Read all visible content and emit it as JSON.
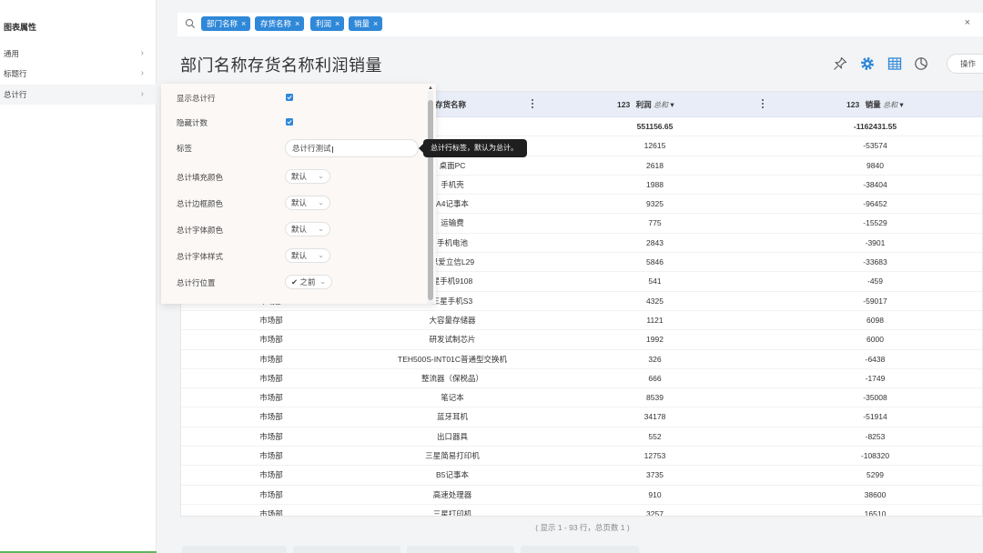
{
  "left_panel": {
    "title": "图表属性",
    "items": [
      {
        "label": "通用"
      },
      {
        "label": "标题行"
      },
      {
        "label": "总计行"
      }
    ]
  },
  "filters": {
    "chips": [
      {
        "label": "部门名称"
      },
      {
        "label": "存货名称"
      },
      {
        "label": "利润"
      },
      {
        "label": "销量"
      }
    ],
    "clear_symbol": "×"
  },
  "page_title": "部门名称存货名称利润销量",
  "toolbar": {
    "pin_icon": "pin-icon",
    "settings_icon": "gear-icon",
    "table_icon": "table-icon",
    "chart_icon": "pie-chart-icon",
    "operation_label": "操作",
    "accent_color": "#2f88d8"
  },
  "table": {
    "headers": {
      "col2": "存货名称",
      "col3_type": "123",
      "col3_name": "利润",
      "col3_agg": "总和",
      "col4_type": "123",
      "col4_name": "销量",
      "col4_agg": "总和"
    },
    "total_row": {
      "profit": "551156.65",
      "sales": "-1162431.55"
    },
    "rows": [
      {
        "dept": "",
        "item": "",
        "profit": "12615",
        "sales": "-53574"
      },
      {
        "dept": "",
        "item": "桌面PC",
        "profit": "2618",
        "sales": "9840"
      },
      {
        "dept": "",
        "item": "手机壳",
        "profit": "1988",
        "sales": "-38404"
      },
      {
        "dept": "",
        "item": "A4记事本",
        "profit": "9325",
        "sales": "-96452"
      },
      {
        "dept": "",
        "item": "运输费",
        "profit": "775",
        "sales": "-15529"
      },
      {
        "dept": "",
        "item": "手机电池",
        "profit": "2843",
        "sales": "-3901"
      },
      {
        "dept": "",
        "item": "思爱立信L29",
        "profit": "5846",
        "sales": "-33683"
      },
      {
        "dept": "",
        "item": "星手机9108",
        "profit": "541",
        "sales": "-459"
      },
      {
        "dept": "市场部",
        "item": "三星手机S3",
        "profit": "4325",
        "sales": "-59017"
      },
      {
        "dept": "市场部",
        "item": "大容量存储器",
        "profit": "1121",
        "sales": "6098"
      },
      {
        "dept": "市场部",
        "item": "研发试制芯片",
        "profit": "1992",
        "sales": "6000"
      },
      {
        "dept": "市场部",
        "item": "TEH500S-INT01C普通型交换机",
        "profit": "326",
        "sales": "-6438"
      },
      {
        "dept": "市场部",
        "item": "整流器（保税品）",
        "profit": "666",
        "sales": "-1749"
      },
      {
        "dept": "市场部",
        "item": "笔记本",
        "profit": "8539",
        "sales": "-35008"
      },
      {
        "dept": "市场部",
        "item": "蓝牙耳机",
        "profit": "34178",
        "sales": "-51914"
      },
      {
        "dept": "市场部",
        "item": "出口器具",
        "profit": "552",
        "sales": "-8253"
      },
      {
        "dept": "市场部",
        "item": "三星简易打印机",
        "profit": "12753",
        "sales": "-108320"
      },
      {
        "dept": "市场部",
        "item": "B5记事本",
        "profit": "3735",
        "sales": "5299"
      },
      {
        "dept": "市场部",
        "item": "高速处理器",
        "profit": "910",
        "sales": "38600"
      },
      {
        "dept": "市场部",
        "item": "三星打印机",
        "profit": "3257",
        "sales": "16510"
      }
    ],
    "footer": "( 显示 1 - 93 行，总页数 1 )"
  },
  "property_panel": {
    "show_total_label": "显示总计行",
    "show_total_checked": true,
    "hide_count_label": "隐藏计数",
    "hide_count_checked": true,
    "label_label": "标签",
    "label_value": "总计行测试",
    "fill_color_label": "总计填充颜色",
    "fill_color_value": "默认",
    "border_color_label": "总计边框颜色",
    "border_color_value": "默认",
    "font_color_label": "总计字体颜色",
    "font_color_value": "默认",
    "font_style_label": "总计字体样式",
    "font_style_value": "默认",
    "position_label": "总计行位置",
    "position_value": "✔ 之前"
  },
  "tooltip": "总计行标签，默认为总计。"
}
